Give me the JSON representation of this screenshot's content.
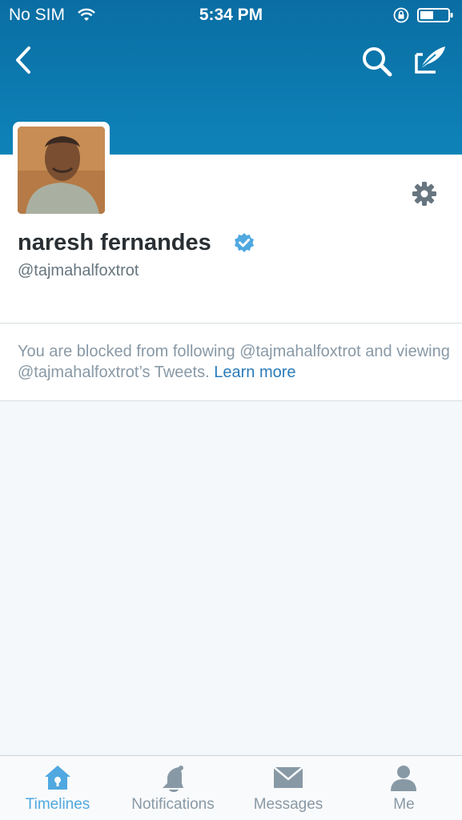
{
  "status_bar": {
    "carrier": "No SIM",
    "time": "5:34 PM"
  },
  "nav": {
    "back_icon": "chevron-left-icon",
    "search_icon": "search-icon",
    "compose_icon": "compose-tweet-icon"
  },
  "profile": {
    "display_name": "naresh fernandes",
    "screen_name": "@tajmahalfoxtrot",
    "verified": true
  },
  "blocked": {
    "message": "You are blocked from following @tajmahalfoxtrot and viewing @tajmahalfoxtrot’s Tweets.",
    "link": "Learn more"
  },
  "tabs": [
    {
      "label": "Timelines",
      "icon": "home-icon",
      "active": true
    },
    {
      "label": "Notifications",
      "icon": "bell-icon",
      "active": false
    },
    {
      "label": "Messages",
      "icon": "envelope-icon",
      "active": false
    },
    {
      "label": "Me",
      "icon": "person-icon",
      "active": false
    }
  ],
  "colors": {
    "header": "#0e83b8",
    "accent": "#4fa8e0",
    "link": "#2b7bb9",
    "verified": "#4fa8e0"
  }
}
